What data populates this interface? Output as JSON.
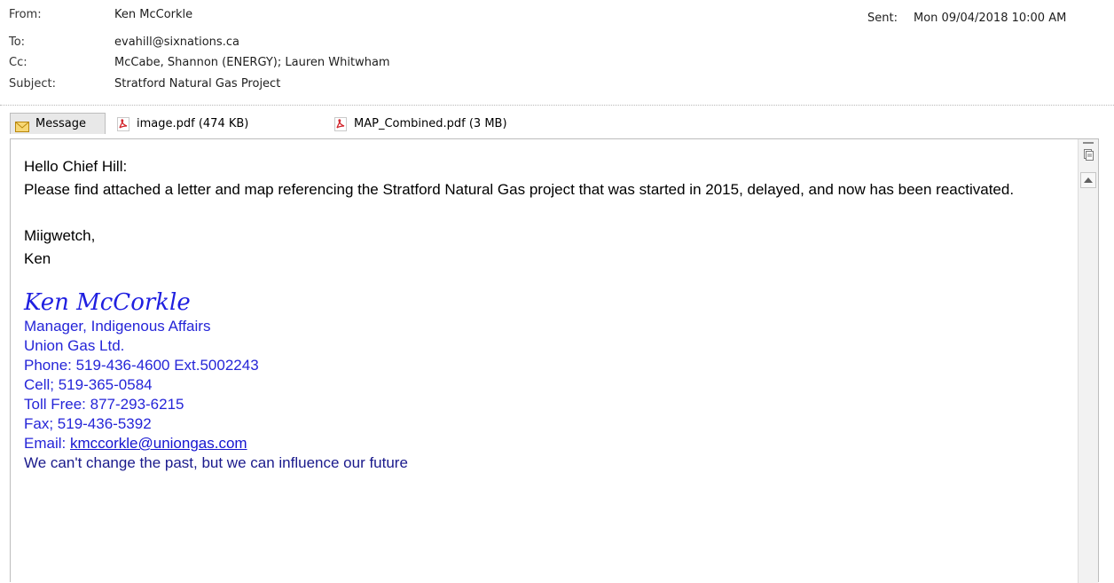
{
  "header": {
    "from_label": "From:",
    "from_value": "Ken McCorkle",
    "to_label": "To:",
    "to_value": "evahill@sixnations.ca",
    "cc_label": "Cc:",
    "cc_value": "McCabe, Shannon (ENERGY); Lauren Whitwham",
    "subject_label": "Subject:",
    "subject_value": "Stratford Natural Gas Project",
    "sent_label": "Sent:",
    "sent_value": "Mon 09/04/2018 10:00 AM"
  },
  "attachments": {
    "message_tab": "Message",
    "items": [
      {
        "label": "image.pdf (474 KB)",
        "icon": "pdf-icon"
      },
      {
        "label": "MAP_Combined.pdf (3 MB)",
        "icon": "pdf-icon"
      }
    ]
  },
  "body": {
    "greeting": "Hello Chief Hill:",
    "paragraph": "Please find attached a letter and map referencing the Stratford Natural Gas project that was started in 2015, delayed, and now has been reactivated.",
    "closing": "Miigwetch,",
    "name": "Ken"
  },
  "signature": {
    "name_script": "Ken McCorkle",
    "title": "Manager, Indigenous Affairs",
    "company": "Union Gas Ltd.",
    "phone": "Phone: 519-436-4600 Ext.5002243",
    "cell": "Cell; 519-365-0584",
    "toll_free": "Toll Free: 877-293-6215",
    "fax": "Fax; 519-436-5392",
    "email_label": "Email: ",
    "email": "kmccorkle@uniongas.com",
    "motto": "We can't change the past, but we can influence our future"
  },
  "colors": {
    "signature_blue": "#2525d8",
    "name_blue": "#1f1fe0",
    "motto_navy": "#1a1a8c"
  }
}
